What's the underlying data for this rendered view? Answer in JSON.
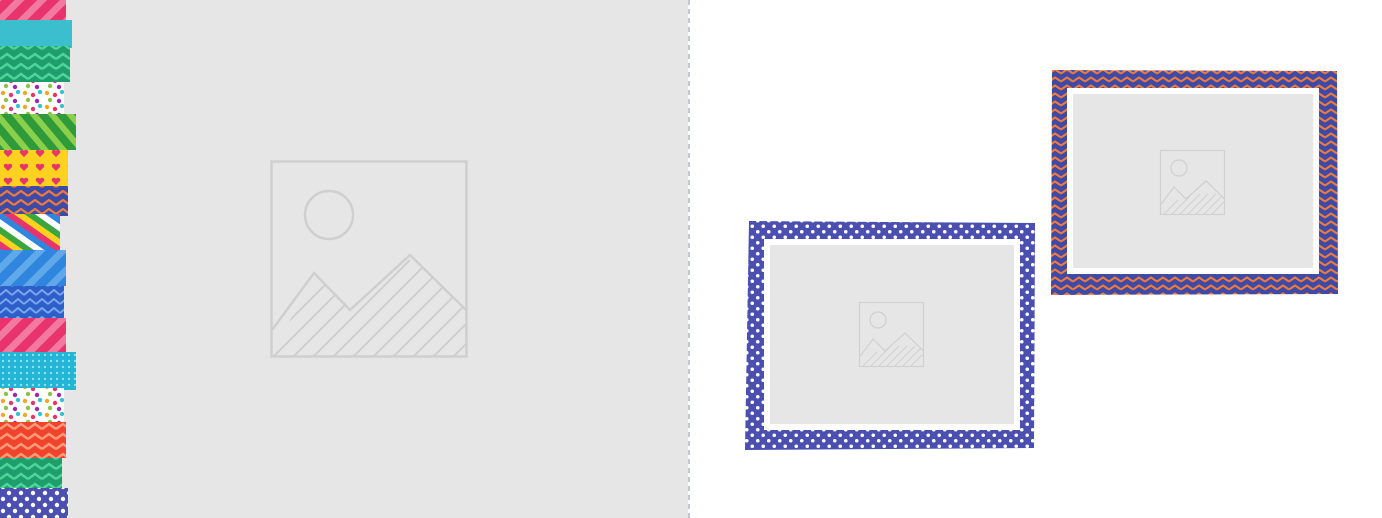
{
  "canvas": {
    "left_page_color": "#e6e6e6",
    "right_page_color": "#ffffff",
    "placeholder_icon": "image-placeholder-icon"
  },
  "washi_tapes": [
    {
      "pattern": "diagonal-stripes",
      "colors": [
        "#e8336d",
        "#f06c97"
      ]
    },
    {
      "pattern": "solid",
      "colors": [
        "#3bbfcf"
      ]
    },
    {
      "pattern": "chevron",
      "colors": [
        "#1f9e6b",
        "#37c08a"
      ]
    },
    {
      "pattern": "confetti-dots",
      "colors": [
        "#ffffff",
        "#f5a623",
        "#e8336d",
        "#3bbfcf",
        "#8bc34a"
      ]
    },
    {
      "pattern": "diagonal-stripes",
      "colors": [
        "#3aa63f",
        "#8bd04a"
      ]
    },
    {
      "pattern": "hearts",
      "colors": [
        "#ffd21f",
        "#e8336d"
      ]
    },
    {
      "pattern": "chevron",
      "colors": [
        "#3d4aa6",
        "#f07a3c"
      ]
    },
    {
      "pattern": "rainbow-stripes",
      "colors": [
        "#e8336d",
        "#ffd21f",
        "#3aa63f",
        "#2e86de"
      ]
    },
    {
      "pattern": "diagonal-stripes",
      "colors": [
        "#2e86de",
        "#5fa8ea"
      ]
    },
    {
      "pattern": "chevron",
      "colors": [
        "#2e5fc9",
        "#5b8ee6"
      ]
    },
    {
      "pattern": "diagonal-stripes",
      "colors": [
        "#d8245f",
        "#ef5a8a"
      ]
    },
    {
      "pattern": "dots",
      "colors": [
        "#22b5d6",
        "#8fe0f0"
      ]
    },
    {
      "pattern": "confetti-dots",
      "colors": [
        "#ffffff",
        "#f5a623",
        "#e8336d",
        "#3bbfcf",
        "#8bc34a"
      ]
    },
    {
      "pattern": "chevron",
      "colors": [
        "#f0432c",
        "#ff8a65"
      ]
    },
    {
      "pattern": "chevron",
      "colors": [
        "#1f9e6b",
        "#37c08a"
      ]
    },
    {
      "pattern": "polka-dots",
      "colors": [
        "#4a4fb0",
        "#ffffff"
      ]
    }
  ],
  "frames": [
    {
      "name": "polka-dot-frame",
      "pattern": "polka-dots",
      "colors": [
        "#4a4fb0",
        "#ffffff"
      ]
    },
    {
      "name": "chevron-frame",
      "pattern": "chevron",
      "colors": [
        "#3d4aa6",
        "#f07a3c"
      ]
    }
  ]
}
